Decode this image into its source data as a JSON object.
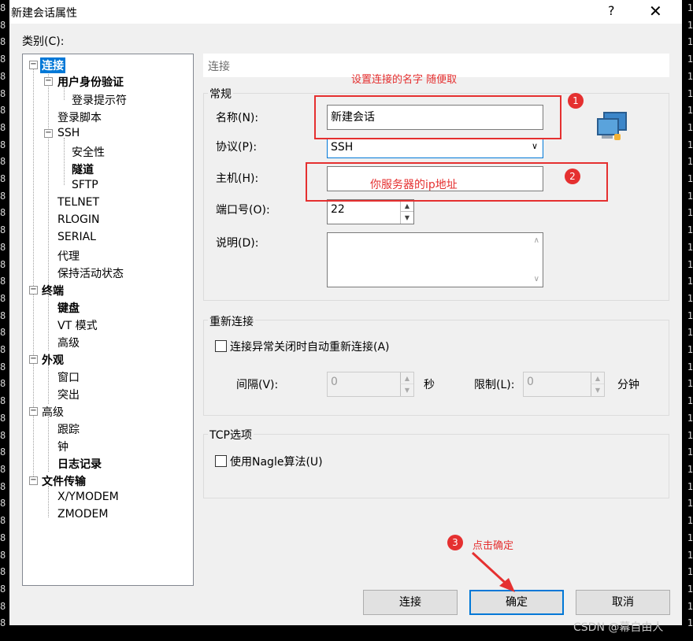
{
  "window": {
    "title": "新建会话属性",
    "help": "?",
    "close": "✕"
  },
  "category_label": "类别(C):",
  "tree": {
    "connection": "连接",
    "auth": "用户身份验证",
    "login_prompt": "登录提示符",
    "login_script": "登录脚本",
    "ssh": "SSH",
    "security": "安全性",
    "tunnel": "隧道",
    "sftp": "SFTP",
    "telnet": "TELNET",
    "rlogin": "RLOGIN",
    "serial": "SERIAL",
    "proxy": "代理",
    "keepalive": "保持活动状态",
    "terminal": "终端",
    "keyboard": "键盘",
    "vt_mode": "VT 模式",
    "advanced1": "高级",
    "appearance": "外观",
    "window": "窗口",
    "highlight": "突出",
    "advanced2": "高级",
    "trace": "跟踪",
    "bell": "钟",
    "logging": "日志记录",
    "file_transfer": "文件传输",
    "xymodem": "X/YMODEM",
    "zmodem": "ZMODEM"
  },
  "panel_header": "连接",
  "general": {
    "title": "常规",
    "name_label": "名称(N):",
    "name_value": "新建会话",
    "protocol_label": "协议(P):",
    "protocol_value": "SSH",
    "host_label": "主机(H):",
    "host_value": "",
    "port_label": "端口号(O):",
    "port_value": "22",
    "desc_label": "说明(D):",
    "desc_value": ""
  },
  "reconnect": {
    "title": "重新连接",
    "checkbox_label": "连接异常关闭时自动重新连接(A)",
    "interval_label": "间隔(V):",
    "interval_value": "0",
    "interval_unit": "秒",
    "limit_label": "限制(L):",
    "limit_value": "0",
    "limit_unit": "分钟"
  },
  "tcp": {
    "title": "TCP选项",
    "nagle_label": "使用Nagle算法(U)"
  },
  "buttons": {
    "connect": "连接",
    "ok": "确定",
    "cancel": "取消"
  },
  "annotations": {
    "note1": "设置连接的名字 随便取",
    "num1": "1",
    "note2": "你服务器的ip地址",
    "num2": "2",
    "note3": "点击确定",
    "num3": "3"
  },
  "watermark": "CSDN @幕自由人",
  "colors": {
    "annotation": "#e53030",
    "focus": "#0078d7"
  }
}
